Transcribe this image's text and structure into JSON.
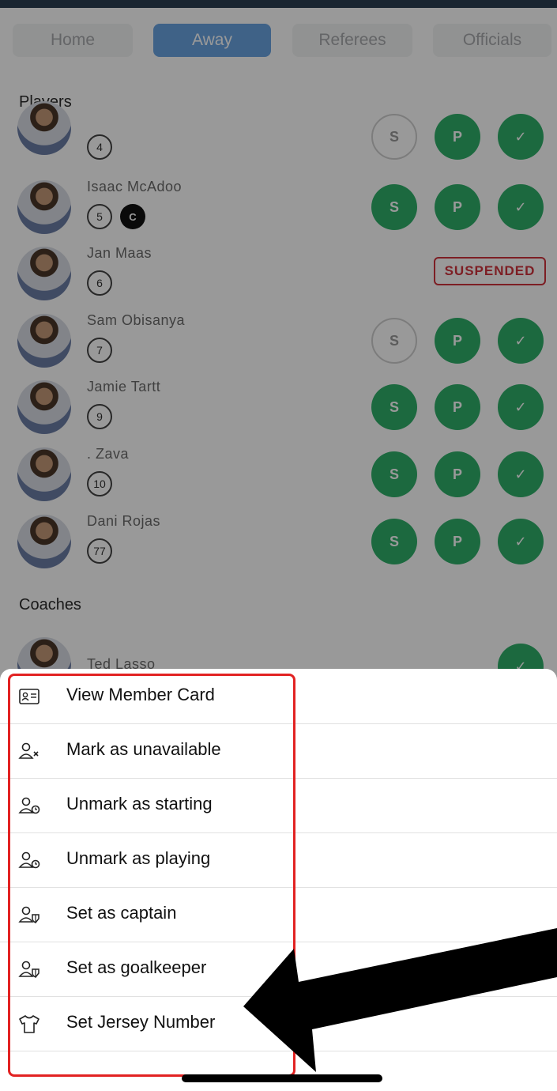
{
  "tabs": [
    {
      "label": "Home",
      "active": false
    },
    {
      "label": "Away",
      "active": true
    },
    {
      "label": "Referees",
      "active": false
    },
    {
      "label": "Officials",
      "active": false
    }
  ],
  "sections": {
    "players": "Players",
    "coaches": "Coaches"
  },
  "players": [
    {
      "name": "",
      "number": "4",
      "captain": false,
      "starting": false,
      "playing": true,
      "status": "available"
    },
    {
      "name": "Isaac  McAdoo",
      "number": "5",
      "captain": true,
      "captain_label": "C",
      "starting": true,
      "playing": true,
      "status": "available"
    },
    {
      "name": "Jan  Maas",
      "number": "6",
      "captain": false,
      "status": "suspended",
      "status_label": "SUSPENDED"
    },
    {
      "name": "Sam  Obisanya",
      "number": "7",
      "captain": false,
      "starting": false,
      "playing": true,
      "status": "available"
    },
    {
      "name": "Jamie  Tartt",
      "number": "9",
      "captain": false,
      "starting": true,
      "playing": true,
      "status": "available"
    },
    {
      "name": ".  Zava",
      "number": "10",
      "captain": false,
      "starting": true,
      "playing": true,
      "status": "available"
    },
    {
      "name": "Dani  Rojas",
      "number": "77",
      "captain": false,
      "starting": true,
      "playing": true,
      "status": "available"
    }
  ],
  "status_buttons": {
    "starting": "S",
    "playing": "P",
    "checked": "✓"
  },
  "coaches": [
    {
      "name": "Ted  Lasso"
    }
  ],
  "menu": [
    {
      "label": "View Member Card",
      "icon": "member-card-icon"
    },
    {
      "label": "Mark as unavailable",
      "icon": "user-x-icon"
    },
    {
      "label": "Unmark as starting",
      "icon": "user-clock-icon"
    },
    {
      "label": "Unmark as playing",
      "icon": "user-clock-icon"
    },
    {
      "label": "Set as captain",
      "icon": "user-shield-icon"
    },
    {
      "label": "Set as goalkeeper",
      "icon": "user-shield-icon"
    },
    {
      "label": "Set Jersey Number",
      "icon": "jersey-icon"
    }
  ],
  "colors": {
    "accent": "#6aa3e2",
    "green": "#2fb06a",
    "suspended": "#d0323c",
    "highlight": "#e22222"
  }
}
